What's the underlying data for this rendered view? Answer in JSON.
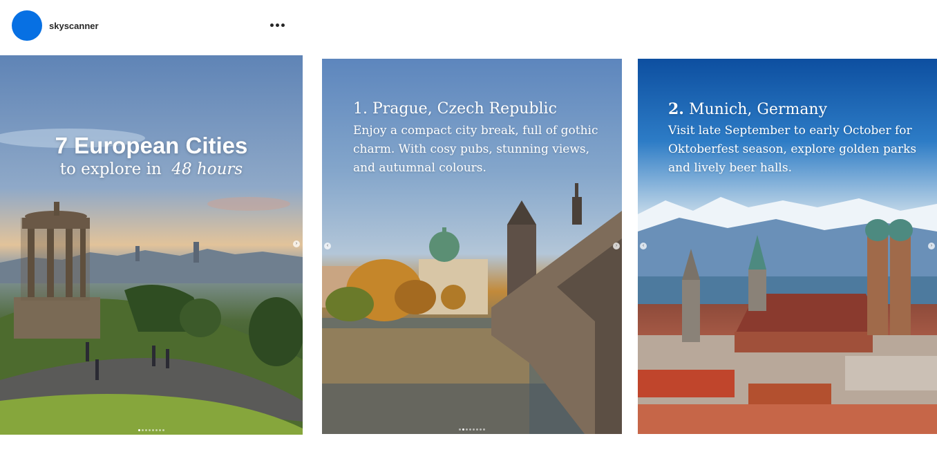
{
  "account": {
    "username": "skyscanner"
  },
  "menu": {
    "more_icon": "more-horizontal-icon"
  },
  "posts": [
    {
      "title": "7 European Cities",
      "subtitle_prefix": "to explore in",
      "subtitle_emphasis": "48 hours"
    },
    {
      "title": "1. Prague, Czech Republic",
      "body": "Enjoy a compact city break, full of gothic charm. With cosy pubs, stunning views, and autumnal colours."
    },
    {
      "title_number": "2.",
      "title_text": "Munich, Germany",
      "body": "Visit late September to early October for Oktoberfest season, explore golden parks and lively beer halls."
    }
  ],
  "colors": {
    "avatar": "#0770e3",
    "text": "#262626",
    "caption": "#ffffff"
  }
}
